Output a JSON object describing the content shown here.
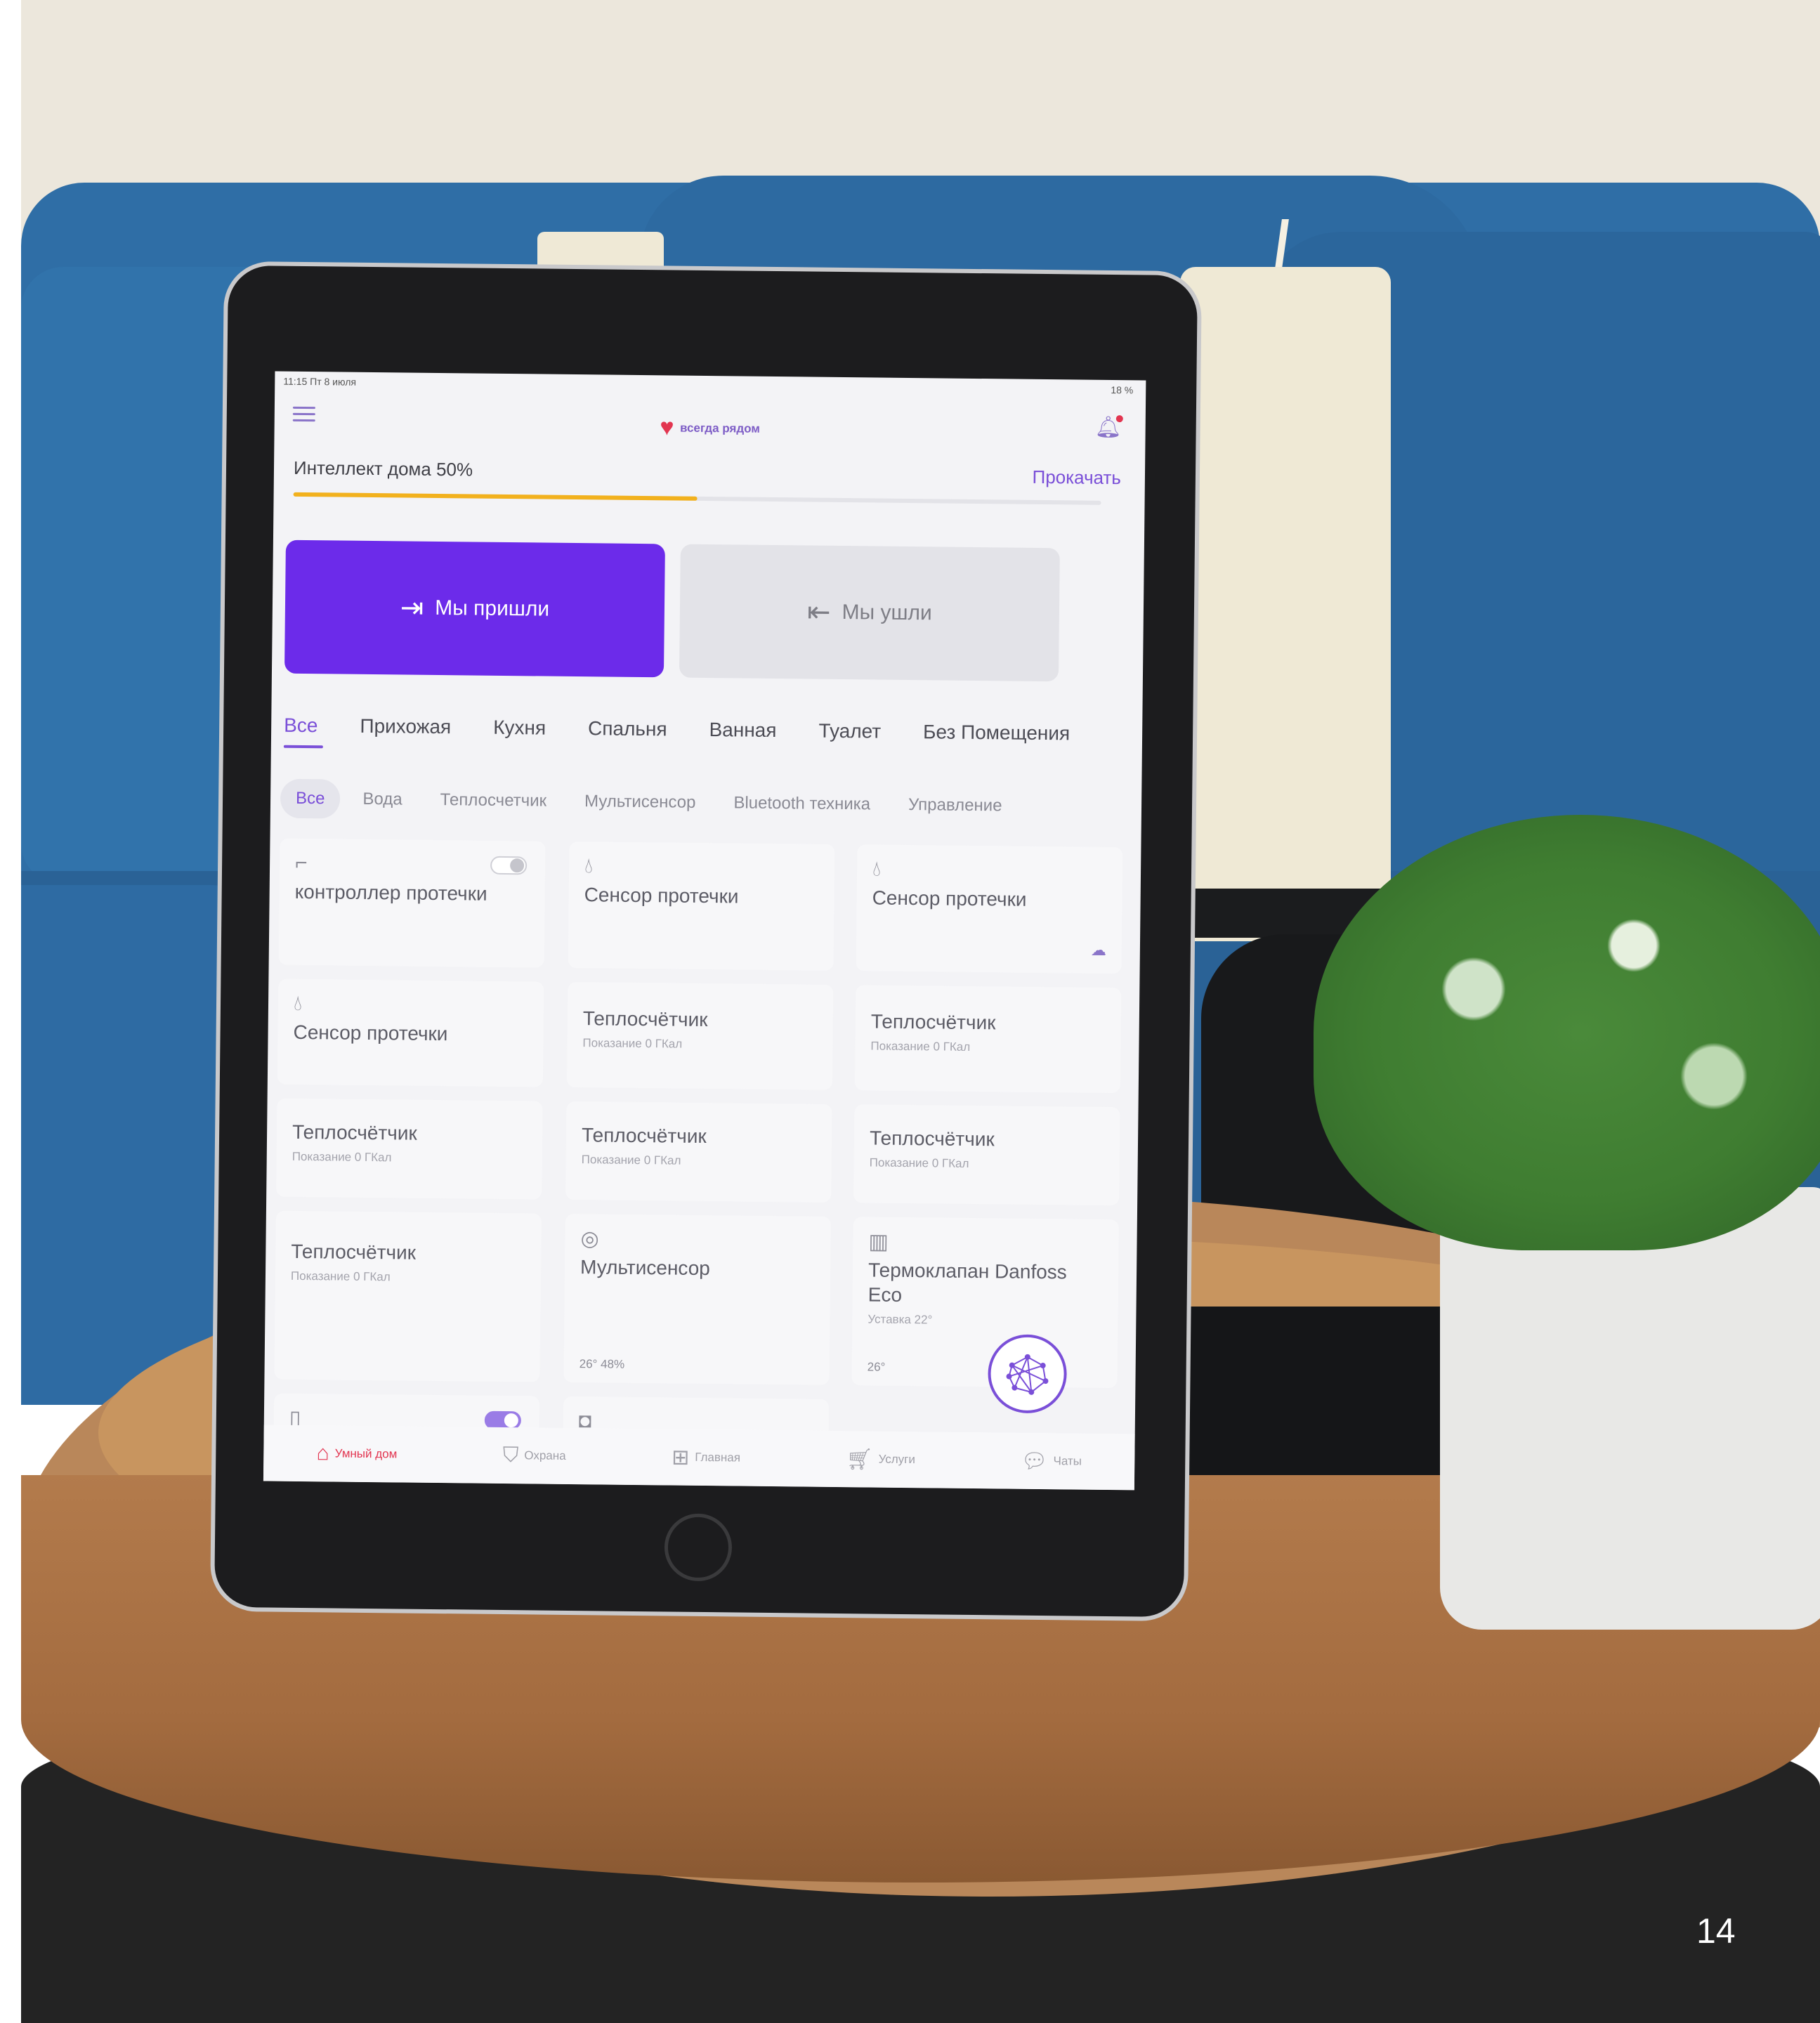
{
  "page_number": "14",
  "app": {
    "status_bar": {
      "time": "11:15  Пт 8 июля",
      "battery": "18 %"
    },
    "brand": {
      "name": "всегда рядом"
    },
    "intelligence": {
      "label": "Интеллект дома 50%",
      "value_percent": 50,
      "link": "Прокачать"
    },
    "actions": {
      "arrived": "Мы пришли",
      "left": "Мы ушли"
    },
    "room_tabs": [
      "Все",
      "Прихожая",
      "Кухня",
      "Спальня",
      "Ванная",
      "Туалет",
      "Без Помещения"
    ],
    "active_room_tab": "Все",
    "category_chips": [
      "Все",
      "Вода",
      "Теплосчетчик",
      "Мультисенсор",
      "Bluetooth техника",
      "Управление"
    ],
    "active_category": "Все",
    "devices": [
      {
        "title": "контроллер протечки",
        "icon": "tap-icon",
        "toggle": "off"
      },
      {
        "title": "Сенсор протечки",
        "icon": "drop-icon"
      },
      {
        "title": "Сенсор протечки",
        "icon": "drop-icon"
      },
      {
        "title": "Сенсор протечки",
        "icon": "drop-icon"
      },
      {
        "title": "Теплосчётчик",
        "sub": "Показание 0 ГКал"
      },
      {
        "title": "Теплосчётчик",
        "sub": "Показание 0 ГКал"
      },
      {
        "title": "Теплосчётчик",
        "sub": "Показание 0 ГКал"
      },
      {
        "title": "Теплосчётчик",
        "sub": "Показание 0 ГКал"
      },
      {
        "title": "Теплосчётчик",
        "sub": "Показание 0 ГКал"
      },
      {
        "title": "Теплосчётчик",
        "sub": "Показание 0 ГКал"
      },
      {
        "title": "Мультисенсор",
        "icon": "sensor-icon",
        "meta": "26°  48%"
      },
      {
        "title": "Термоклапан Danfoss Eco",
        "icon": "radiator-icon",
        "sub": "Уставка 22°",
        "meta": "26°"
      }
    ],
    "bottom_nav": [
      "Умный дом",
      "Охрана",
      "Главная",
      "Услуги",
      "Чаты"
    ],
    "active_nav": "Умный дом",
    "colors": {
      "accent": "#6c2bea",
      "brand_red": "#e23550",
      "progress": "#f2b11d"
    }
  }
}
